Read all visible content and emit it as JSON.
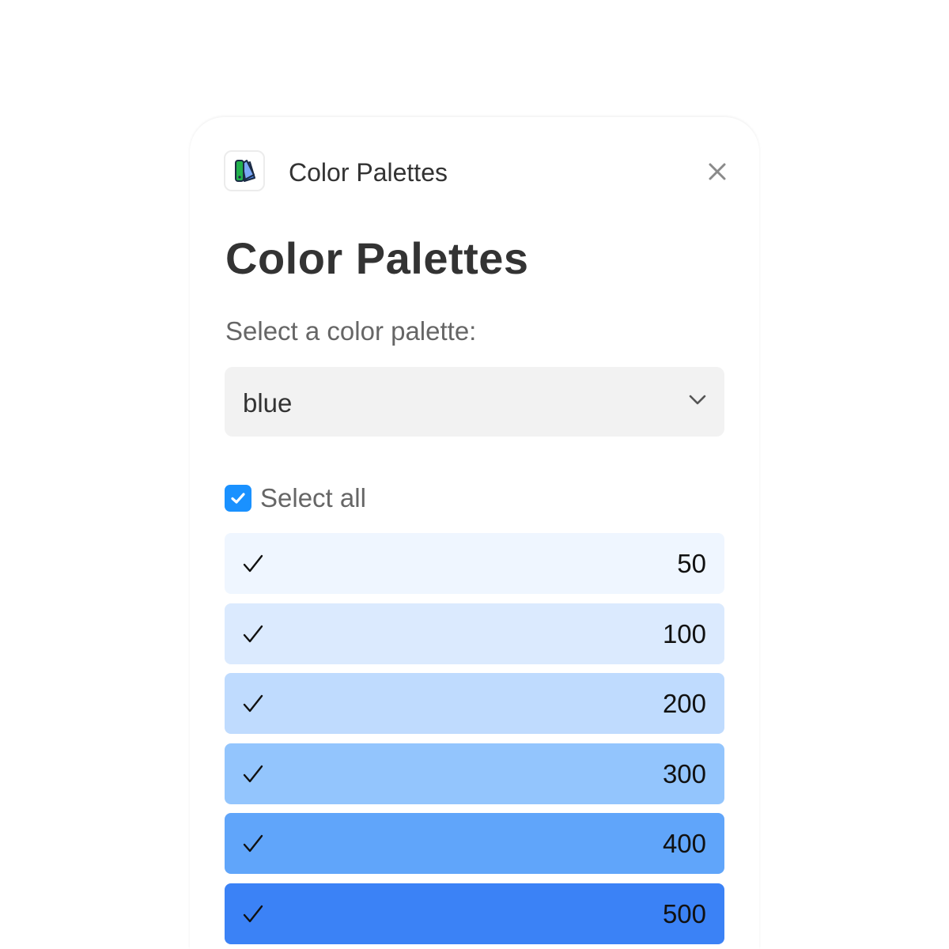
{
  "header": {
    "app_icon": "color-swatch-icon",
    "title": "Color Palettes",
    "close_icon": "close-icon"
  },
  "main": {
    "title": "Color Palettes",
    "select_label": "Select a color palette:",
    "palette_select": {
      "value": "blue",
      "icon": "chevron-down-icon"
    },
    "select_all": {
      "label": "Select all",
      "checked": true,
      "color": "#1a91ff"
    },
    "shades": [
      {
        "label": "50",
        "color": "#eff6ff",
        "checked": true
      },
      {
        "label": "100",
        "color": "#dbeafe",
        "checked": true
      },
      {
        "label": "200",
        "color": "#bfdbfe",
        "checked": true
      },
      {
        "label": "300",
        "color": "#93c5fd",
        "checked": true
      },
      {
        "label": "400",
        "color": "#60a5fa",
        "checked": true
      },
      {
        "label": "500",
        "color": "#3b82f6",
        "checked": true
      }
    ]
  }
}
